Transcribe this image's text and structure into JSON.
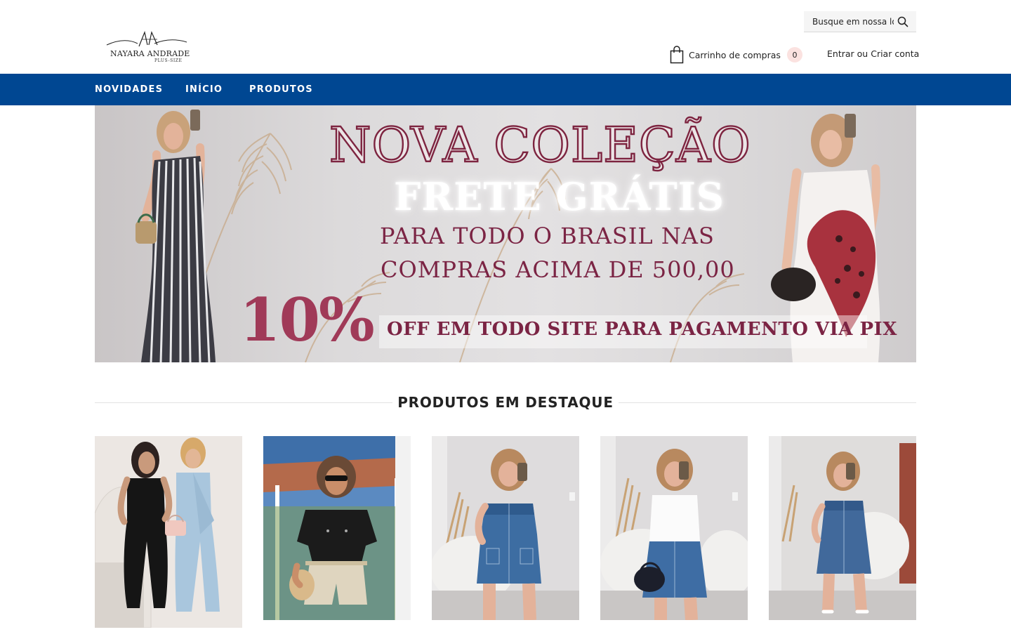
{
  "header": {
    "logo": {
      "monogram": "NA",
      "brand": "NAYARA ANDRADE",
      "tagline": "PLUS-SIZE",
      "icon": "logo-script-icon"
    },
    "search": {
      "placeholder": "Busque em nossa loja",
      "icon": "search-icon"
    },
    "cart": {
      "label": "Carrinho de compras",
      "count": "0",
      "icon": "shopping-bag-icon"
    },
    "account": {
      "login": "Entrar",
      "separator": "ou",
      "register": "Criar conta"
    }
  },
  "nav": {
    "items": [
      {
        "label": "NOVIDADES"
      },
      {
        "label": "INÍCIO"
      },
      {
        "label": "PRODUTOS"
      }
    ],
    "background": "#004792"
  },
  "banner": {
    "headline": "NOVA COLEÇÃO",
    "frete": "FRETE GRÁTIS",
    "line1": "PARA TODO O BRASIL NAS",
    "line2": "COMPRAS ACIMA DE 500,00",
    "discount": "10%",
    "discount_text": "OFF EM TODO  SITE PARA PAGAMENTO VIA PIX",
    "accent_color": "#7b2444"
  },
  "featured": {
    "title": "PRODUTOS EM DESTAQUE",
    "products": [
      {
        "image": "product-photo-jumpsuits"
      },
      {
        "image": "product-photo-black-shirt-shorts"
      },
      {
        "image": "product-photo-denim-strapless-dress"
      },
      {
        "image": "product-photo-white-top-denim-skirt"
      },
      {
        "image": "product-photo-denim-mini-dress"
      }
    ]
  }
}
